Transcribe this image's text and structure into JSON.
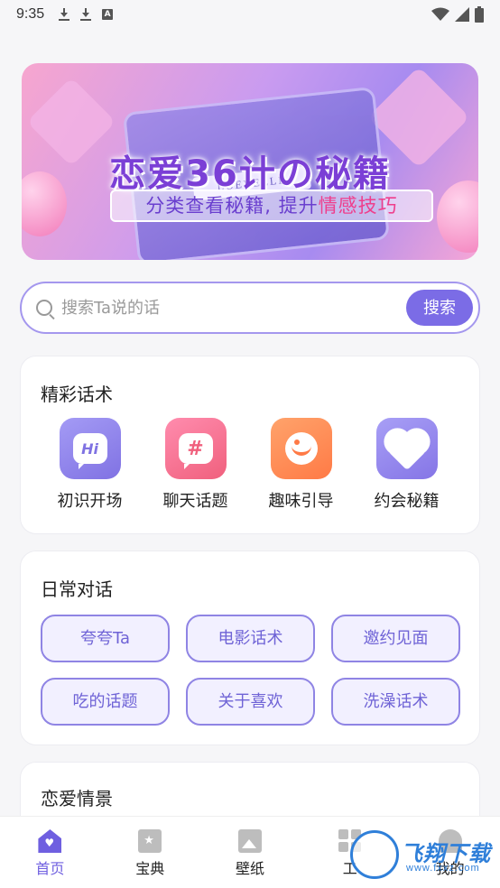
{
  "status_bar": {
    "time": "9:35",
    "left_icons": [
      "download-icon",
      "download-icon",
      "a-notification-icon"
    ],
    "right_icons": [
      "wifi-icon",
      "signal-icon",
      "battery-icon"
    ]
  },
  "banner": {
    "title": "恋爱36计の秘籍",
    "subtitle_prefix": "分类查看秘籍, 提升",
    "subtitle_highlight": "情感技巧",
    "book_label": "LOEVELLE"
  },
  "search": {
    "placeholder": "搜索Ta说的话",
    "button_label": "搜索"
  },
  "featured": {
    "title": "精彩话术",
    "items": [
      {
        "label": "初识开场",
        "icon": "hi-bubble-icon",
        "icon_text": "Hi"
      },
      {
        "label": "聊天话题",
        "icon": "hashtag-bubble-icon",
        "icon_text": "#"
      },
      {
        "label": "趣味引导",
        "icon": "planet-icon"
      },
      {
        "label": "约会秘籍",
        "icon": "couple-heart-icon"
      }
    ]
  },
  "daily": {
    "title": "日常对话",
    "chips": [
      "夸夸Ta",
      "电影话术",
      "邀约见面",
      "吃的话题",
      "关于喜欢",
      "洗澡话术"
    ]
  },
  "scenes": {
    "title": "恋爱情景"
  },
  "bottom_nav": {
    "items": [
      {
        "label": "首页",
        "icon": "home-icon",
        "active": true
      },
      {
        "label": "宝典",
        "icon": "book-icon",
        "active": false
      },
      {
        "label": "壁纸",
        "icon": "image-icon",
        "active": false
      },
      {
        "label": "工",
        "icon": "grid-icon",
        "active": false
      },
      {
        "label": "我的",
        "icon": "user-icon",
        "active": false
      }
    ]
  },
  "watermark": {
    "text": "飞翔下载",
    "url": "www.fxxz.com"
  },
  "colors": {
    "accent": "#7b6ce6",
    "chip_border": "#8f84e4",
    "chip_bg": "#f2f0ff",
    "highlight": "#ef3e8c"
  }
}
